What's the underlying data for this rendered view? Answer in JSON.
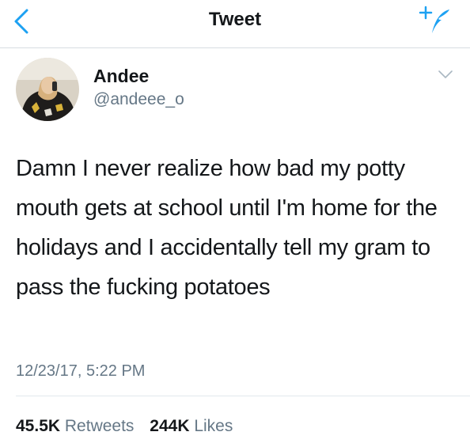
{
  "header": {
    "title": "Tweet",
    "back_icon": "chevron-left-icon",
    "compose_icon": "compose-tweet-icon",
    "accent_color": "#1da1f2"
  },
  "tweet": {
    "author": {
      "display_name": "Andee",
      "handle": "@andeee_o"
    },
    "menu_icon": "chevron-down-icon",
    "text": "Damn I never realize how bad my potty mouth gets at school until I'm home for the holidays and I accidentally tell my gram to pass the fucking potatoes",
    "timestamp": "12/23/17, 5:22 PM",
    "stats": {
      "retweets_count": "45.5K",
      "retweets_label": "Retweets",
      "likes_count": "244K",
      "likes_label": "Likes"
    }
  }
}
